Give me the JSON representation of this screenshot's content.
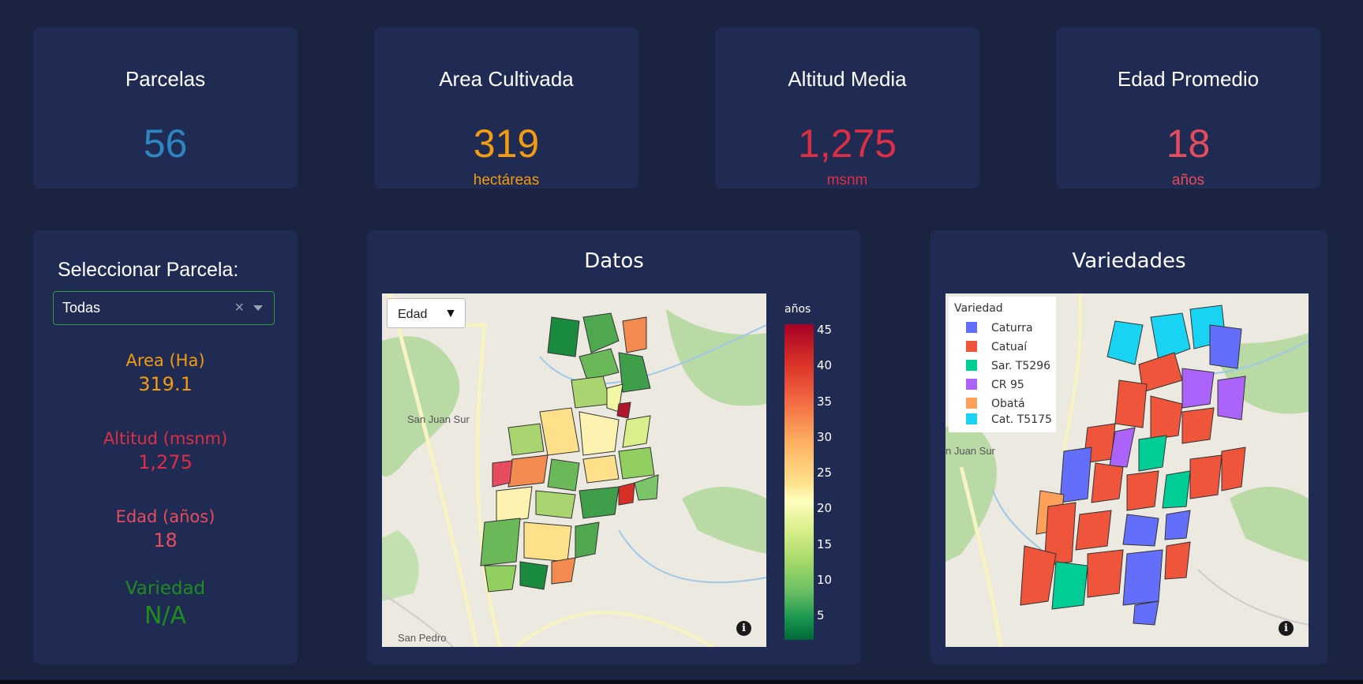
{
  "kpis": [
    {
      "title": "Parcelas",
      "value": "56",
      "unit": "",
      "color": "#2e86c1"
    },
    {
      "title": "Area Cultivada",
      "value": "319",
      "unit": "hectáreas",
      "color": "#f39c12"
    },
    {
      "title": "Altitud Media",
      "value": "1,275",
      "unit": "msnm",
      "color": "#dc2f45"
    },
    {
      "title": "Edad Promedio",
      "value": "18",
      "unit": "años",
      "color": "#e74c5e"
    }
  ],
  "sidebar": {
    "label": "Seleccionar Parcela:",
    "dropdown_value": "Todas",
    "clear_glyph": "×",
    "stats": [
      {
        "label": "Area (Ha)",
        "value": "319.1",
        "color": "#f39c12"
      },
      {
        "label": "Altitud (msnm)",
        "value": "1,275",
        "color": "#dc2f45"
      },
      {
        "label": "Edad (años)",
        "value": "18",
        "color": "#e74c5e"
      },
      {
        "label": "Variedad",
        "value": "N/A",
        "color": "#1e8c1e"
      }
    ]
  },
  "datos_panel": {
    "title": "Datos",
    "selector_value": "Edad",
    "selector_arrow": "▼",
    "colorbar_title": "años",
    "colorbar_ticks": [
      "45",
      "40",
      "35",
      "30",
      "25",
      "20",
      "15",
      "10",
      "5"
    ],
    "places": [
      "San Juan Sur",
      "San Pedro"
    ],
    "info_glyph": "i"
  },
  "variedades_panel": {
    "title": "Variedades",
    "legend_title": "Variedad",
    "legend": [
      {
        "label": "Caturra",
        "color": "#636efa"
      },
      {
        "label": "Catuaí",
        "color": "#ef553b"
      },
      {
        "label": "Sar. T5296",
        "color": "#00cc96"
      },
      {
        "label": "CR 95",
        "color": "#ab63fa"
      },
      {
        "label": "Obatá",
        "color": "#ffa15a"
      },
      {
        "label": "Cat. T5175",
        "color": "#19d3f3"
      }
    ],
    "places": [
      "n Juan Sur"
    ],
    "info_glyph": "i"
  }
}
